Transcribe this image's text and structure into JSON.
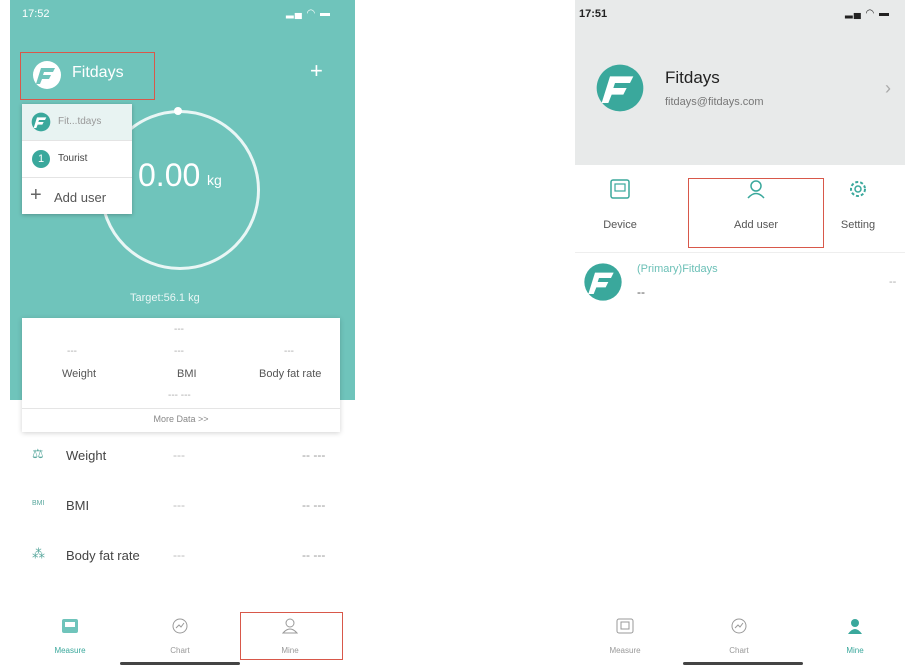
{
  "left_screen": {
    "status_time": "17:52",
    "brand_name": "Fitdays",
    "add_button": "+",
    "user_menu": {
      "current_user": "Fit...tdays",
      "tourist": "Tourist",
      "tourist_icon_glyph": "1",
      "add_user": "Add user"
    },
    "weight_value": "0.00",
    "weight_unit": "kg",
    "target": "Target:56.1 kg",
    "summary_card": {
      "top_dash": "---",
      "metrics": [
        {
          "label": "Weight",
          "value": "---"
        },
        {
          "label": "BMI",
          "value": "---"
        },
        {
          "label": "Body fat rate",
          "value": "---"
        }
      ],
      "bottom_dash": "--- ---",
      "more_data": "More Data >>"
    },
    "list": [
      {
        "icon": "scale-icon",
        "glyph": "⚖",
        "label": "Weight",
        "mid": "---",
        "value": "-- ---"
      },
      {
        "icon": "bmi-icon",
        "glyph": "BMI",
        "label": "BMI",
        "mid": "---",
        "value": "-- ---"
      },
      {
        "icon": "body-fat-icon",
        "glyph": "⁂",
        "label": "Body fat rate",
        "mid": "---",
        "value": "-- ---"
      }
    ],
    "tabs": [
      {
        "label": "Measure",
        "icon": "measure-icon"
      },
      {
        "label": "Chart",
        "icon": "chart-icon"
      },
      {
        "label": "Mine",
        "icon": "person-icon"
      }
    ]
  },
  "right_screen": {
    "status_time": "17:51",
    "profile_name": "Fitdays",
    "profile_email": "fitdays@fitdays.com",
    "actions": [
      {
        "label": "Device",
        "icon": "device-icon"
      },
      {
        "label": "Add user",
        "icon": "add-user-icon"
      },
      {
        "label": "Setting",
        "icon": "gear-icon"
      }
    ],
    "primary_user_name": "(Primary)Fitdays",
    "primary_user_sub": "--",
    "primary_user_end": "--",
    "tabs": [
      {
        "label": "Measure",
        "icon": "measure-icon"
      },
      {
        "label": "Chart",
        "icon": "chart-icon"
      },
      {
        "label": "Mine",
        "icon": "person-icon"
      }
    ]
  },
  "colors": {
    "teal": "#6fc4bb",
    "accent": "#3aa89c",
    "highlight_border": "#d8584a"
  }
}
